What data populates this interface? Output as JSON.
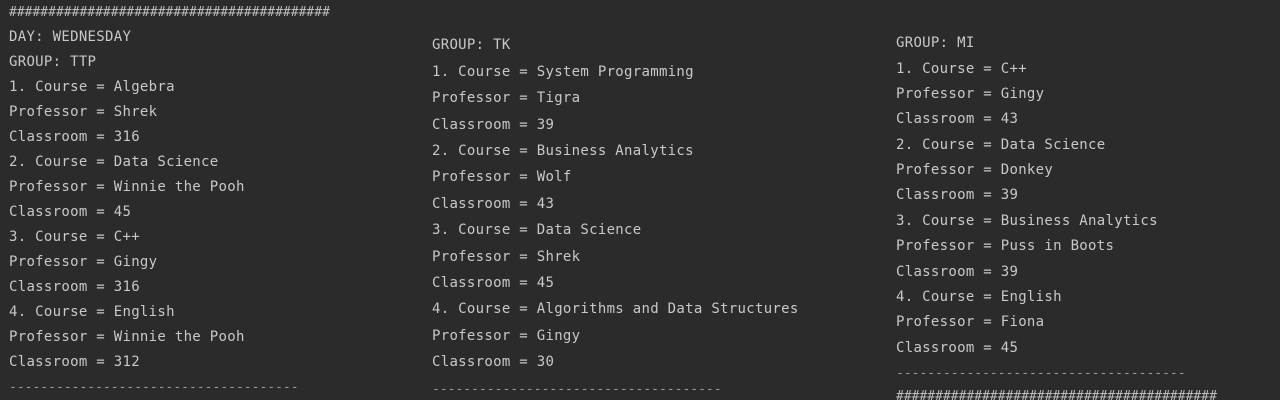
{
  "output": {
    "top_separator": "#########################################",
    "day_line": "DAY: WEDNESDAY",
    "groups": [
      {
        "header": "GROUP: TTP",
        "lines": [
          "1. Course = Algebra",
          "Professor = Shrek",
          "Classroom = 316",
          "2. Course = Data Science",
          "Professor = Winnie the Pooh",
          "Classroom = 45",
          "3. Course = C++",
          "Professor = Gingy",
          "Classroom = 316",
          "4. Course = English",
          "Professor = Winnie the Pooh",
          "Classroom = 312"
        ],
        "footer": "-------------------------------------"
      },
      {
        "header": "GROUP: TK",
        "lines": [
          "1. Course = System Programming",
          "Professor = Tigra",
          "Classroom = 39",
          "2. Course = Business Analytics",
          "Professor = Wolf",
          "Classroom = 43",
          "3. Course = Data Science",
          "Professor = Shrek",
          "Classroom = 45",
          "4. Course = Algorithms and Data Structures",
          "Professor = Gingy",
          "Classroom = 30"
        ],
        "footer": "-------------------------------------"
      },
      {
        "header": "GROUP: MI",
        "lines": [
          "1. Course = C++",
          "Professor = Gingy",
          "Classroom = 43",
          "2. Course = Data Science",
          "Professor = Donkey",
          "Classroom = 39",
          "3. Course = Business Analytics",
          "Professor = Puss in Boots",
          "Classroom = 39",
          "4. Course = English",
          "Professor = Fiona",
          "Classroom = 45"
        ],
        "footer": "-------------------------------------",
        "bottom_separator": "#########################################"
      }
    ]
  }
}
